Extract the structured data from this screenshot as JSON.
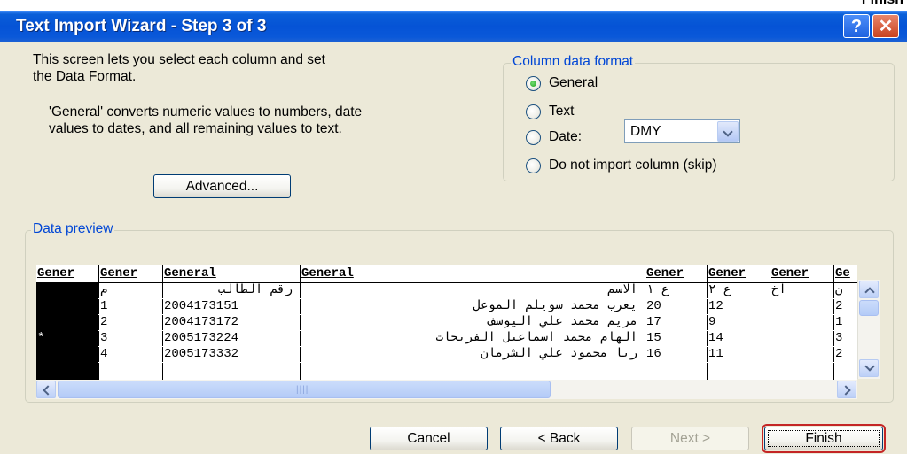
{
  "corner_label": "Finish",
  "window": {
    "title": "Text Import Wizard - Step 3 of 3",
    "help_label": "?",
    "close_label": "✕"
  },
  "intro": {
    "line1": "This screen lets you select each column and set",
    "line2": "the Data Format.",
    "general1": "'General' converts numeric values to numbers, date",
    "general2": "values to dates, and all remaining values to text."
  },
  "advanced_label": "Advanced...",
  "format": {
    "legend": "Column data format",
    "options": [
      "General",
      "Text",
      "Date:",
      "Do not import column (skip)"
    ],
    "selected": "General",
    "date_value": "DMY"
  },
  "preview": {
    "legend": "Data preview",
    "headers": [
      "Gener",
      "Gener",
      "General",
      "General",
      "Gener",
      "Gener",
      "Gener",
      "Ge"
    ],
    "rows": [
      [
        "",
        "م",
        "رقم الطالب",
        "الاسم",
        "ع ١",
        "ع ٢",
        "اخ",
        "ن"
      ],
      [
        "",
        "1",
        "2004173151",
        "يعرب محمد سويلم الموعل",
        "20",
        "12",
        "",
        "2"
      ],
      [
        "",
        "2",
        "2004173172",
        "مريم محمد علي اليوسف",
        "17",
        "9",
        "",
        "1"
      ],
      [
        "*",
        "3",
        "2005173224",
        "الهام محمد اسماعيل الفريحات",
        "15",
        "14",
        "",
        "3"
      ],
      [
        "",
        "4",
        "2005173332",
        "ربا محمود علي الشرمان",
        "16",
        "11",
        "",
        "2"
      ]
    ],
    "hscroll_grip": "||||"
  },
  "buttons": {
    "cancel": "Cancel",
    "back": "< Back",
    "next": "Next >",
    "finish": "Finish"
  },
  "colors": {
    "title_bar": "#0553d6",
    "dialog_bg": "#ece9d8",
    "group_legend": "#0046d5",
    "default_button_outline": "#c42525"
  }
}
